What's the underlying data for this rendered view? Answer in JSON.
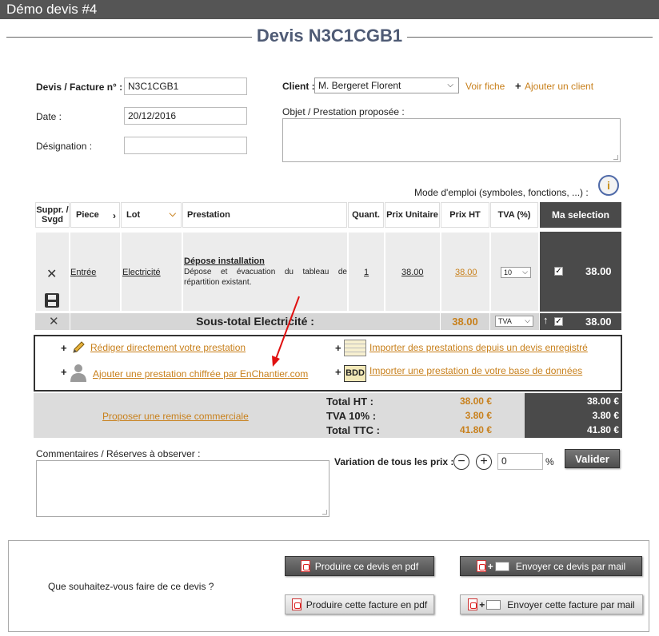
{
  "window": {
    "title": "Démo devis #4"
  },
  "doc_title": "Devis N3C1CGB1",
  "form": {
    "devis_label": "Devis / Facture n° :",
    "devis_value": "N3C1CGB1",
    "date_label": "Date :",
    "date_value": "20/12/2016",
    "designation_label": "Désignation :",
    "designation_value": "",
    "client_label": "Client :",
    "client_value": "M. Bergeret Florent",
    "voir_fiche": "Voir fiche",
    "add_client_plus": "+",
    "add_client": "Ajouter un client",
    "objet_label": "Objet / Prestation proposée :",
    "objet_value": "",
    "mode_emploi": "Mode d'emploi (symboles, fonctions, ...) :"
  },
  "table": {
    "headers": {
      "suppr": "Suppr. / Svgd",
      "piece": "Piece",
      "lot": "Lot",
      "prestation": "Prestation",
      "quant": "Quant.",
      "prix_unitaire": "Prix Unitaire",
      "prix_ht": "Prix HT",
      "tva": "TVA (%)",
      "ma_selection": "Ma selection"
    },
    "row": {
      "piece": "Entrée",
      "lot": "Electricité",
      "prestation_title": "Dépose installation",
      "prestation_desc": "Dépose et évacuation du tableau de répartition existant.",
      "quant": "1",
      "prix_unitaire": "38.00",
      "prix_ht": "38.00",
      "tva": "10",
      "selection": "38.00"
    },
    "subtotal": {
      "label": "Sous-total Electricité :",
      "prix_ht": "38.00",
      "tva": "TVA",
      "selection": "38.00"
    }
  },
  "tools": {
    "rediger": "Rédiger directement votre prestation",
    "ajouter_chiffree": "Ajouter une prestation chiffrée par EnChantier.com",
    "importer_devis": "Importer des prestations depuis un devis enregistré",
    "importer_bdd": "Importer une prestation de votre base de données",
    "bdd_icon_text": "BDD",
    "plus": "+"
  },
  "totals": {
    "remise": "Proposer une remise commerciale",
    "ht_label": "Total HT :",
    "ht_value": "38.00 €",
    "tva_label": "TVA 10% :",
    "tva_value": "3.80 €",
    "ttc_label": "Total TTC :",
    "ttc_value": "41.80 €",
    "sel_ht": "38.00 €",
    "sel_tva": "3.80 €",
    "sel_ttc": "41.80 €"
  },
  "comments": {
    "label": "Commentaires / Réserves à observer :",
    "value": ""
  },
  "variation": {
    "label": "Variation de tous les prix :",
    "minus": "−",
    "plus": "+",
    "value": "0",
    "unit": "%",
    "valider": "Valider"
  },
  "actions": {
    "question": "Que souhaitez-vous faire de ce devis ?",
    "pdf_devis": "Produire ce devis en pdf",
    "mail_devis": "Envoyer ce devis par mail",
    "pdf_facture": "Produire cette facture en pdf",
    "mail_facture": "Envoyer cette facture par mail",
    "plus": "+"
  },
  "colors": {
    "accent_orange": "#c8801c",
    "title_blue": "#4f5b75",
    "dark_panel": "#4a4a4a"
  }
}
